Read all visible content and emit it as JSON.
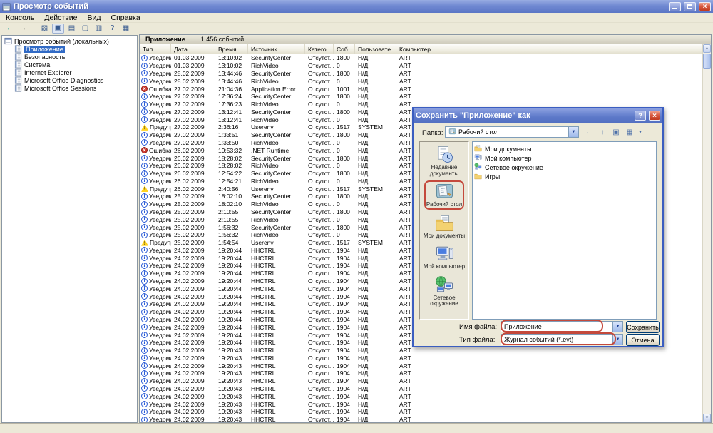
{
  "icons": {
    "up": "▲",
    "down": "▼",
    "caret": "▾",
    "help": "?",
    "close": "×"
  },
  "window": {
    "title": "Просмотр событий"
  },
  "menu": {
    "items": [
      "Консоль",
      "Действие",
      "Вид",
      "Справка"
    ]
  },
  "toolbar": {
    "icons": [
      {
        "name": "back-icon",
        "glyph": "←",
        "color": "#0b9a8d"
      },
      {
        "name": "forward-icon",
        "glyph": "→",
        "color": "#9a9a8e"
      },
      {
        "name": "separator"
      },
      {
        "name": "show-tree-icon",
        "glyph": "▧"
      },
      {
        "name": "console-window-icon",
        "glyph": "▣",
        "pressed": true
      },
      {
        "name": "properties-icon",
        "glyph": "▤"
      },
      {
        "name": "page-icon",
        "glyph": "▢"
      },
      {
        "name": "export-list-icon",
        "glyph": "▥"
      },
      {
        "name": "help-icon",
        "glyph": "?"
      },
      {
        "name": "grid-icon",
        "glyph": "▦"
      }
    ]
  },
  "tree": {
    "root": "Просмотр событий (локальных)",
    "items": [
      {
        "label": "Приложение",
        "selected": true
      },
      {
        "label": "Безопасность"
      },
      {
        "label": "Система"
      },
      {
        "label": "Internet Explorer"
      },
      {
        "label": "Microsoft Office Diagnostics"
      },
      {
        "label": "Microsoft Office Sessions"
      }
    ]
  },
  "result_pane": {
    "title": "Приложение",
    "count": "1 456 событий",
    "columns": [
      "Тип",
      "Дата",
      "Время",
      "Источник",
      "Катего...",
      "Соб...",
      "Пользовате...",
      "Компьютер"
    ],
    "type_labels": {
      "info": "Уведомл...",
      "error": "Ошибка",
      "warning": "Предупр..."
    },
    "rows": [
      [
        "info",
        "01.03.2009",
        "13:10:02",
        "SecurityCenter",
        "Отсутст...",
        "1800",
        "Н/Д",
        "ART"
      ],
      [
        "info",
        "01.03.2009",
        "13:10:02",
        "RichVideo",
        "Отсутст...",
        "0",
        "Н/Д",
        "ART"
      ],
      [
        "info",
        "28.02.2009",
        "13:44:46",
        "SecurityCenter",
        "Отсутст...",
        "1800",
        "Н/Д",
        "ART"
      ],
      [
        "info",
        "28.02.2009",
        "13:44:46",
        "RichVideo",
        "Отсутст...",
        "0",
        "Н/Д",
        "ART"
      ],
      [
        "error",
        "27.02.2009",
        "21:04:36",
        "Application Error",
        "Отсутст...",
        "1001",
        "Н/Д",
        "ART"
      ],
      [
        "info",
        "27.02.2009",
        "17:36:24",
        "SecurityCenter",
        "Отсутст...",
        "1800",
        "Н/Д",
        "ART"
      ],
      [
        "info",
        "27.02.2009",
        "17:36:23",
        "RichVideo",
        "Отсутст...",
        "0",
        "Н/Д",
        "ART"
      ],
      [
        "info",
        "27.02.2009",
        "13:12:41",
        "SecurityCenter",
        "Отсутст...",
        "1800",
        "Н/Д",
        "ART"
      ],
      [
        "info",
        "27.02.2009",
        "13:12:41",
        "RichVideo",
        "Отсутст...",
        "0",
        "Н/Д",
        "ART"
      ],
      [
        "warning",
        "27.02.2009",
        "2:36:16",
        "Userenv",
        "Отсутст...",
        "1517",
        "SYSTEM",
        "ART"
      ],
      [
        "info",
        "27.02.2009",
        "1:33:51",
        "SecurityCenter",
        "Отсутст...",
        "1800",
        "Н/Д",
        "ART"
      ],
      [
        "info",
        "27.02.2009",
        "1:33:50",
        "RichVideo",
        "Отсутст...",
        "0",
        "Н/Д",
        "ART"
      ],
      [
        "error",
        "26.02.2009",
        "19:53:32",
        ".NET Runtime",
        "Отсутст...",
        "0",
        "Н/Д",
        "ART"
      ],
      [
        "info",
        "26.02.2009",
        "18:28:02",
        "SecurityCenter",
        "Отсутст...",
        "1800",
        "Н/Д",
        "ART"
      ],
      [
        "info",
        "26.02.2009",
        "18:28:02",
        "RichVideo",
        "Отсутст...",
        "0",
        "Н/Д",
        "ART"
      ],
      [
        "info",
        "26.02.2009",
        "12:54:22",
        "SecurityCenter",
        "Отсутст...",
        "1800",
        "Н/Д",
        "ART"
      ],
      [
        "info",
        "26.02.2009",
        "12:54:21",
        "RichVideo",
        "Отсутст...",
        "0",
        "Н/Д",
        "ART"
      ],
      [
        "warning",
        "26.02.2009",
        "2:40:56",
        "Userenv",
        "Отсутст...",
        "1517",
        "SYSTEM",
        "ART"
      ],
      [
        "info",
        "25.02.2009",
        "18:02:10",
        "SecurityCenter",
        "Отсутст...",
        "1800",
        "Н/Д",
        "ART"
      ],
      [
        "info",
        "25.02.2009",
        "18:02:10",
        "RichVideo",
        "Отсутст...",
        "0",
        "Н/Д",
        "ART"
      ],
      [
        "info",
        "25.02.2009",
        "2:10:55",
        "SecurityCenter",
        "Отсутст...",
        "1800",
        "Н/Д",
        "ART"
      ],
      [
        "info",
        "25.02.2009",
        "2:10:55",
        "RichVideo",
        "Отсутст...",
        "0",
        "Н/Д",
        "ART"
      ],
      [
        "info",
        "25.02.2009",
        "1:56:32",
        "SecurityCenter",
        "Отсутст...",
        "1800",
        "Н/Д",
        "ART"
      ],
      [
        "info",
        "25.02.2009",
        "1:56:32",
        "RichVideo",
        "Отсутст...",
        "0",
        "Н/Д",
        "ART"
      ],
      [
        "warning",
        "25.02.2009",
        "1:54:54",
        "Userenv",
        "Отсутст...",
        "1517",
        "SYSTEM",
        "ART"
      ],
      [
        "info",
        "24.02.2009",
        "19:20:44",
        "HHCTRL",
        "Отсутст...",
        "1904",
        "Н/Д",
        "ART"
      ],
      [
        "info",
        "24.02.2009",
        "19:20:44",
        "HHCTRL",
        "Отсутст...",
        "1904",
        "Н/Д",
        "ART"
      ],
      [
        "info",
        "24.02.2009",
        "19:20:44",
        "HHCTRL",
        "Отсутст...",
        "1904",
        "Н/Д",
        "ART"
      ],
      [
        "info",
        "24.02.2009",
        "19:20:44",
        "HHCTRL",
        "Отсутст...",
        "1904",
        "Н/Д",
        "ART"
      ],
      [
        "info",
        "24.02.2009",
        "19:20:44",
        "HHCTRL",
        "Отсутст...",
        "1904",
        "Н/Д",
        "ART"
      ],
      [
        "info",
        "24.02.2009",
        "19:20:44",
        "HHCTRL",
        "Отсутст...",
        "1904",
        "Н/Д",
        "ART"
      ],
      [
        "info",
        "24.02.2009",
        "19:20:44",
        "HHCTRL",
        "Отсутст...",
        "1904",
        "Н/Д",
        "ART"
      ],
      [
        "info",
        "24.02.2009",
        "19:20:44",
        "HHCTRL",
        "Отсутст...",
        "1904",
        "Н/Д",
        "ART"
      ],
      [
        "info",
        "24.02.2009",
        "19:20:44",
        "HHCTRL",
        "Отсутст...",
        "1904",
        "Н/Д",
        "ART"
      ],
      [
        "info",
        "24.02.2009",
        "19:20:44",
        "HHCTRL",
        "Отсутст...",
        "1904",
        "Н/Д",
        "ART"
      ],
      [
        "info",
        "24.02.2009",
        "19:20:44",
        "HHCTRL",
        "Отсутст...",
        "1904",
        "Н/Д",
        "ART"
      ],
      [
        "info",
        "24.02.2009",
        "19:20:44",
        "HHCTRL",
        "Отсутст...",
        "1904",
        "Н/Д",
        "ART"
      ],
      [
        "info",
        "24.02.2009",
        "19:20:44",
        "HHCTRL",
        "Отсутст...",
        "1904",
        "Н/Д",
        "ART"
      ],
      [
        "info",
        "24.02.2009",
        "19:20:43",
        "HHCTRL",
        "Отсутст...",
        "1904",
        "Н/Д",
        "ART"
      ],
      [
        "info",
        "24.02.2009",
        "19:20:43",
        "HHCTRL",
        "Отсутст...",
        "1904",
        "Н/Д",
        "ART"
      ],
      [
        "info",
        "24.02.2009",
        "19:20:43",
        "HHCTRL",
        "Отсутст...",
        "1904",
        "Н/Д",
        "ART"
      ],
      [
        "info",
        "24.02.2009",
        "19:20:43",
        "HHCTRL",
        "Отсутст...",
        "1904",
        "Н/Д",
        "ART"
      ],
      [
        "info",
        "24.02.2009",
        "19:20:43",
        "HHCTRL",
        "Отсутст...",
        "1904",
        "Н/Д",
        "ART"
      ],
      [
        "info",
        "24.02.2009",
        "19:20:43",
        "HHCTRL",
        "Отсутст...",
        "1904",
        "Н/Д",
        "ART"
      ],
      [
        "info",
        "24.02.2009",
        "19:20:43",
        "HHCTRL",
        "Отсутст...",
        "1904",
        "Н/Д",
        "ART"
      ],
      [
        "info",
        "24.02.2009",
        "19:20:43",
        "HHCTRL",
        "Отсутст...",
        "1904",
        "Н/Д",
        "ART"
      ],
      [
        "info",
        "24.02.2009",
        "19:20:43",
        "HHCTRL",
        "Отсутст...",
        "1904",
        "Н/Д",
        "ART"
      ],
      [
        "info",
        "24.02.2009",
        "19:20:43",
        "HHCTRL",
        "Отсутст...",
        "1904",
        "Н/Д",
        "ART"
      ]
    ]
  },
  "dialog": {
    "title": "Сохранить \"Приложение\" как",
    "folder_label": "Папка:",
    "folder_value": "Рабочий стол",
    "toolbar_icons": [
      {
        "name": "back-folder-icon",
        "glyph": "←"
      },
      {
        "name": "up-level-icon",
        "glyph": "↑"
      },
      {
        "name": "new-folder-icon",
        "glyph": "▣"
      },
      {
        "name": "views-icon",
        "glyph": "▦"
      },
      {
        "name": "views-caret-icon",
        "glyph": "▾",
        "caret": true
      }
    ],
    "places": [
      {
        "label": "Недавние документы",
        "icon": "recent",
        "name": "place-recent-documents"
      },
      {
        "label": "Рабочий стол",
        "icon": "desktop",
        "name": "place-desktop",
        "highlighted": true
      },
      {
        "label": "Мои документы",
        "icon": "docfolder",
        "name": "place-my-documents"
      },
      {
        "label": "Мой компьютер",
        "icon": "computer",
        "name": "place-my-computer"
      },
      {
        "label": "Сетевое окружение",
        "icon": "network",
        "name": "place-network"
      }
    ],
    "files": [
      {
        "label": "Мои документы",
        "icon": "docfolder"
      },
      {
        "label": "Мой компьютер",
        "icon": "computer"
      },
      {
        "label": "Сетевое окружение",
        "icon": "network"
      },
      {
        "label": "Игры",
        "icon": "folder"
      }
    ],
    "filename_label": "Имя файла:",
    "filename_value": "Приложение",
    "filetype_label": "Тип файла:",
    "filetype_value": "Журнал событий (*.evt)",
    "save_button": "Сохранить",
    "cancel_button": "Отмена"
  },
  "colors": {
    "selection": "#316ac5",
    "annotation": "#c4493c",
    "titlebar": "#5b76c5"
  }
}
